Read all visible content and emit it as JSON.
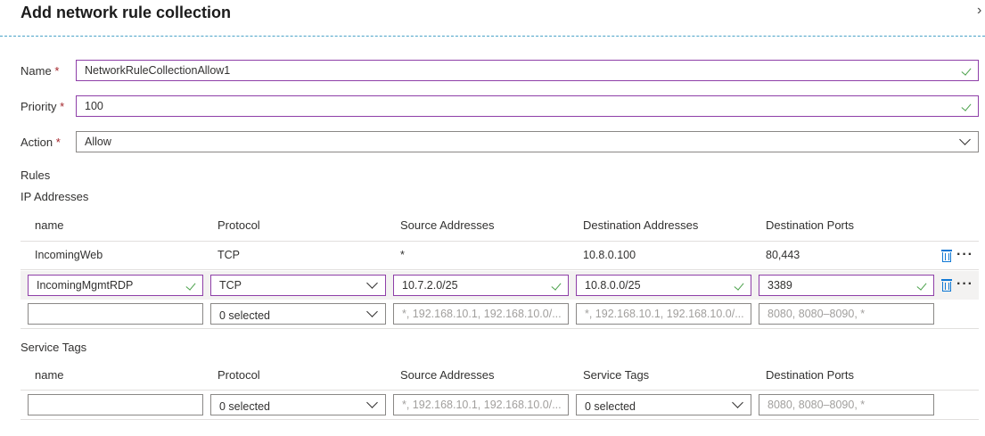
{
  "header": {
    "title": "Add network rule collection",
    "close_glyph": "›"
  },
  "form": {
    "name": {
      "label": "Name",
      "required_mark": "*",
      "value": "NetworkRuleCollectionAllow1"
    },
    "priority": {
      "label": "Priority",
      "required_mark": "*",
      "value": "100"
    },
    "action": {
      "label": "Action",
      "required_mark": "*",
      "value": "Allow"
    }
  },
  "rules": {
    "heading": "Rules",
    "ip": {
      "heading": "IP Addresses",
      "columns": [
        "name",
        "Protocol",
        "Source Addresses",
        "Destination Addresses",
        "Destination Ports"
      ],
      "rows": [
        {
          "name": "IncomingWeb",
          "protocol": "TCP",
          "source": "*",
          "destination": "10.8.0.100",
          "ports": "80,443"
        },
        {
          "name": "IncomingMgmtRDP",
          "protocol": "TCP",
          "source": "10.7.2.0/25",
          "destination": "10.8.0.0/25",
          "ports": "3389"
        }
      ],
      "new_row": {
        "name": "",
        "protocol": "0 selected",
        "source_placeholder": "*, 192.168.10.1, 192.168.10.0/...",
        "destination_placeholder": "*, 192.168.10.1, 192.168.10.0/...",
        "ports_placeholder": "8080, 8080–8090, *"
      }
    },
    "tags": {
      "heading": "Service Tags",
      "columns": [
        "name",
        "Protocol",
        "Source Addresses",
        "Service Tags",
        "Destination Ports"
      ],
      "new_row": {
        "name": "",
        "protocol": "0 selected",
        "source_placeholder": "*, 192.168.10.1, 192.168.10.0/...",
        "tags": "0 selected",
        "ports_placeholder": "8080, 8080–8090, *"
      }
    }
  },
  "icons": {
    "trash": "trash-icon",
    "more": "more-icon",
    "check": "checkmark-icon",
    "chevron": "chevron-down-icon"
  },
  "colors": {
    "valid_border": "#8e3fa8",
    "check": "#4aa14a",
    "accent": "#0f78d4"
  }
}
